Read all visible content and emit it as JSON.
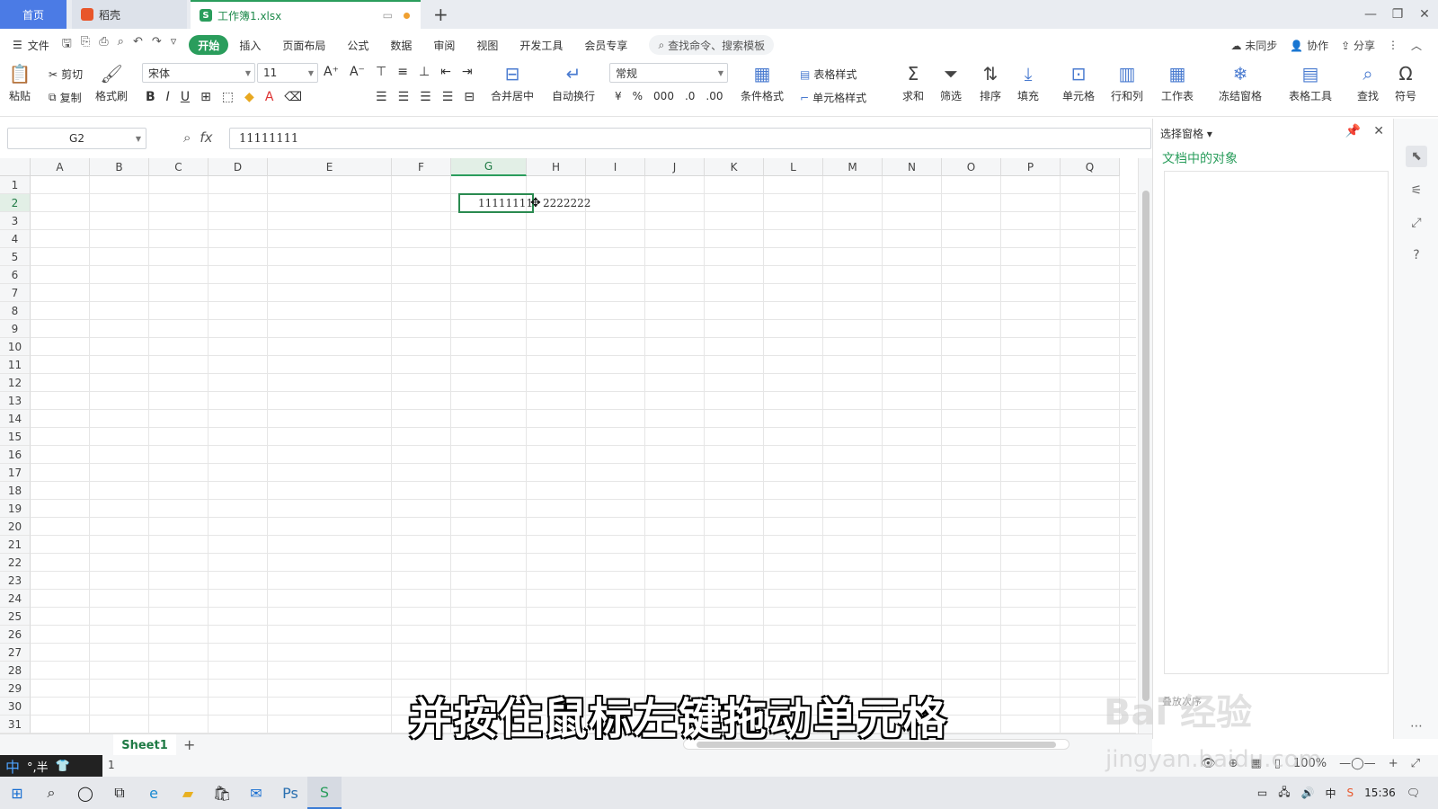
{
  "tabs": {
    "home": "首页",
    "daoke": "稻壳",
    "workbook": "工作簿1.xlsx"
  },
  "menubar": {
    "file": "文件",
    "items": [
      "开始",
      "插入",
      "页面布局",
      "公式",
      "数据",
      "审阅",
      "视图",
      "开发工具",
      "会员专享"
    ],
    "active": "开始",
    "search": "查找命令、搜索模板",
    "right": [
      "未同步",
      "协作",
      "分享"
    ]
  },
  "ribbon": {
    "paste": "粘贴",
    "cut": "剪切",
    "copy": "复制",
    "format_painter": "格式刷",
    "font_name": "宋体",
    "font_size": "11",
    "merge_center": "合并居中",
    "wrap_text": "自动换行",
    "number_format": "常规",
    "cond_format": "条件格式",
    "table_style": "表格样式",
    "cell_style": "单元格样式",
    "sum": "求和",
    "filter": "筛选",
    "sort": "排序",
    "fill": "填充",
    "cell": "单元格",
    "row_col": "行和列",
    "worksheet": "工作表",
    "freeze": "冻结窗格",
    "table_tools": "表格工具",
    "find": "查找",
    "symbol": "符号"
  },
  "formula": {
    "name_box": "G2",
    "fx": "fx",
    "value": "11111111"
  },
  "grid": {
    "columns": [
      "A",
      "B",
      "C",
      "D",
      "E",
      "F",
      "G",
      "H",
      "I",
      "J",
      "K",
      "L",
      "M",
      "N",
      "O",
      "P",
      "Q"
    ],
    "selected_column": "G",
    "selected_row": "2",
    "rows": [
      "1",
      "2",
      "3",
      "4",
      "5",
      "6",
      "7",
      "8",
      "9",
      "10",
      "11",
      "12",
      "13",
      "14",
      "15",
      "16",
      "17",
      "18",
      "19",
      "20",
      "21",
      "22",
      "23",
      "24",
      "25",
      "26",
      "27",
      "28",
      "29",
      "30",
      "31"
    ],
    "cells": {
      "G2": "11111111",
      "H2": "2222222"
    }
  },
  "sidepane": {
    "title": "选择窗格",
    "objects_label": "文档中的对象",
    "bottom_label": "叠放次序"
  },
  "sheets": {
    "active": "Sheet1"
  },
  "status": {
    "ime_zh": "中",
    "ime_extra": "°,半",
    "count": "1",
    "zoom": "100%"
  },
  "taskbar": {
    "time": "15:36"
  },
  "overlay": {
    "subtitle": "并按住鼠标左键拖动单元格",
    "watermark": "Bai 经验",
    "watermark_url": "jingyan.baidu.com"
  },
  "colors": {
    "accent": "#2a9d5c",
    "tab_home": "#4b7be5"
  }
}
